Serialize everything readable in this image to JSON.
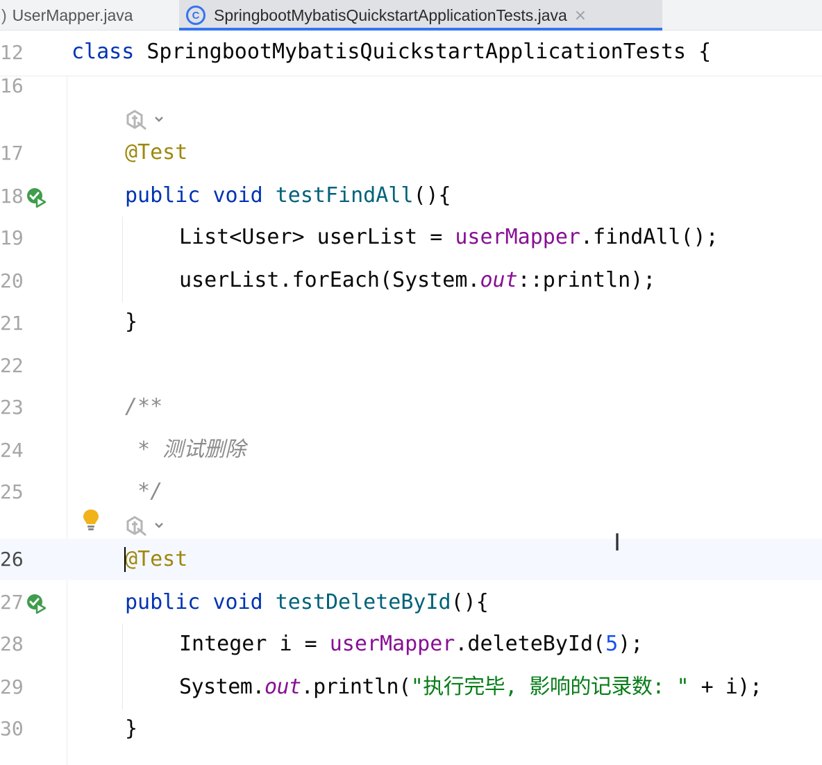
{
  "tabs": [
    {
      "label": "UserMapper.java",
      "lead": ")"
    },
    {
      "label": "SpringbootMybatisQuickstartApplicationTests.java",
      "icon_letter": "C",
      "close": "×"
    }
  ],
  "sticky": {
    "line_number": "12",
    "kw": "class",
    "name": "SpringbootMybatisQuickstartApplicationTests",
    "brace": "{"
  },
  "line_numbers": {
    "l16": "16",
    "l17": "17",
    "l18": "18",
    "l19": "19",
    "l20": "20",
    "l21": "21",
    "l22": "22",
    "l23": "23",
    "l24": "24",
    "l25": "25",
    "l26": "26",
    "l27": "27",
    "l28": "28",
    "l29": "29",
    "l30": "30"
  },
  "code": {
    "l17": {
      "ann": "@Test"
    },
    "l18": {
      "kw1": "public",
      "kw2": "void",
      "fn": "testFindAll",
      "rest": "(){"
    },
    "l19": {
      "a": "List<User> userList = ",
      "field": "userMapper",
      "b": ".findAll();"
    },
    "l20": {
      "a": "userList.forEach(System.",
      "stat": "out",
      "b": "::println);"
    },
    "l21": {
      "brace": "}"
    },
    "l23": {
      "cmt": "/**"
    },
    "l24": {
      "cmt": " * 测试删除"
    },
    "l25": {
      "cmt": " */"
    },
    "l26": {
      "ann": "@Test"
    },
    "l27": {
      "kw1": "public",
      "kw2": "void",
      "fn": "testDeleteById",
      "rest": "(){"
    },
    "l28": {
      "a": "Integer i = ",
      "field": "userMapper",
      "b": ".deleteById(",
      "num": "5",
      "c": ");"
    },
    "l29": {
      "a": "System.",
      "stat": "out",
      "b": ".println(",
      "str": "\"执行完毕, 影响的记录数: \"",
      "c": " + i);"
    },
    "l30": {
      "brace": "}"
    }
  },
  "icons": {
    "run_gutter": "run-test-icon",
    "inlay_hint": "ai-inlay-hint-icon",
    "intention": "lightbulb-icon",
    "cursor": "I"
  }
}
